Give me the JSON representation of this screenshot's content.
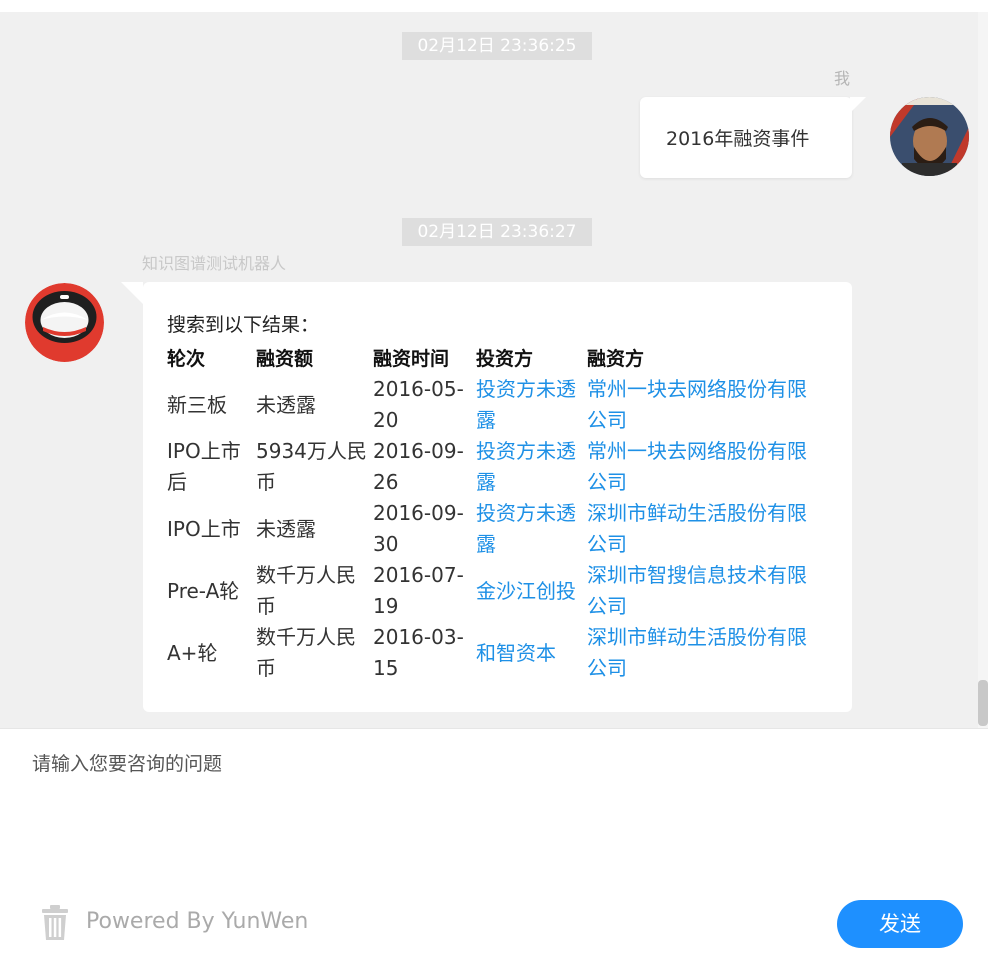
{
  "chat": {
    "timestamp_1": "02月12日 23:36:25",
    "timestamp_2": "02月12日 23:36:27",
    "me_label": "我",
    "user_message": "2016年融资事件",
    "bot_name": "知识图谱测试机器人",
    "bot_intro": "搜索到以下结果：",
    "table": {
      "headers": [
        "轮次",
        "融资额",
        "融资时间",
        "投资方",
        "融资方"
      ],
      "rows": [
        [
          "新三板",
          "未透露",
          "2016-05-20",
          "投资方未透露",
          "常州一块去网络股份有限公司"
        ],
        [
          "IPO上市后",
          "5934万人民币",
          "2016-09-26",
          "投资方未透露",
          "常州一块去网络股份有限公司"
        ],
        [
          "IPO上市",
          "未透露",
          "2016-09-30",
          "投资方未透露",
          "深圳市鲜动生活股份有限公司"
        ],
        [
          "Pre-A轮",
          "数千万人民币",
          "2016-07-19",
          "金沙江创投",
          "深圳市智搜信息技术有限公司"
        ],
        [
          "A+轮",
          "数千万人民币",
          "2016-03-15",
          "和智资本",
          "深圳市鲜动生活股份有限公司"
        ]
      ]
    }
  },
  "input": {
    "placeholder": "请输入您要咨询的问题",
    "powered_by": "Powered By YunWen",
    "send_label": "发送"
  },
  "colors": {
    "accent": "#1e90ff",
    "link": "#1e90e6",
    "chat_background": "#f0f0f0"
  },
  "icons": {
    "trash": "trash-icon",
    "user_avatar": "avatar",
    "bot_avatar": "robot-avatar"
  }
}
